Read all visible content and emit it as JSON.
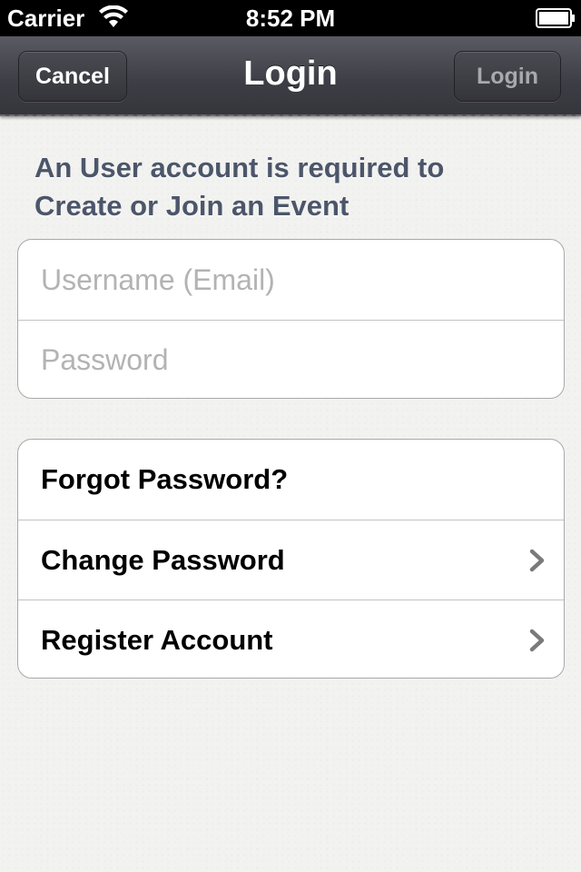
{
  "status_bar": {
    "carrier": "Carrier",
    "time": "8:52 PM",
    "icons": [
      "wifi-icon",
      "battery-icon"
    ]
  },
  "nav_bar": {
    "title": "Login",
    "cancel_label": "Cancel",
    "login_label": "Login"
  },
  "header": {
    "line1": "An User account is required to",
    "line2": "Create or Join an Event"
  },
  "form": {
    "username_placeholder": "Username (Email)",
    "username_value": "",
    "password_placeholder": "Password",
    "password_value": ""
  },
  "actions": [
    {
      "label": "Forgot Password?",
      "icon": ""
    },
    {
      "label": "Change Password",
      "icon": "chevron-right-icon"
    },
    {
      "label": "Register Account",
      "icon": "chevron-right-icon"
    }
  ],
  "colors": {
    "header_text": "#4c566a",
    "nav_bg": "#3d3d45",
    "placeholder": "#b3b3b3"
  }
}
